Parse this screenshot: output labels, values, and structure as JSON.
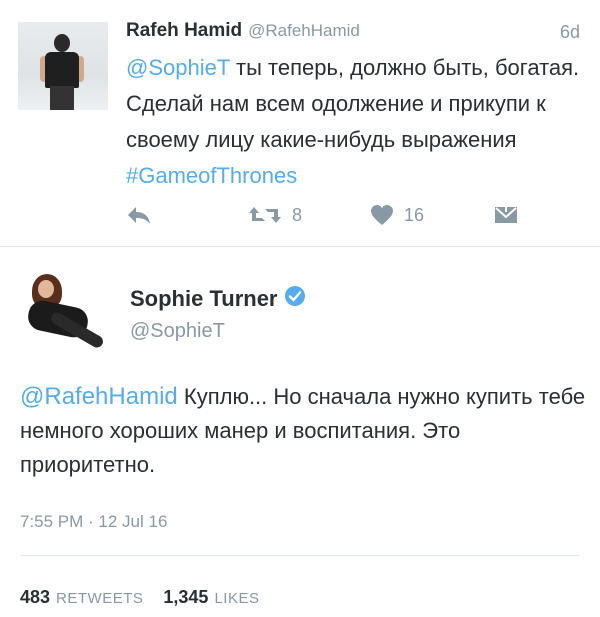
{
  "tweet1": {
    "name": "Rafeh Hamid",
    "handle": "@RafehHamid",
    "time": "6d",
    "mention": "@SophieT",
    "text_main": " ты теперь, должно быть, богатая. Сделай нам всем одолжение и прикупи к своему лицу какие-нибудь выражения ",
    "hashtag": "#GameofThrones",
    "actions": {
      "reply_icon": "reply-icon",
      "retweet_icon": "retweet-icon",
      "retweet_count": "8",
      "like_icon": "heart-icon",
      "like_count": "16",
      "dm_icon": "direct-message-icon"
    }
  },
  "tweet2": {
    "name": "Sophie Turner",
    "verified_icon": "verified-badge-icon",
    "handle": "@SophieT",
    "mention": "@RafehHamid",
    "text_main": " Куплю... Но сначала нужно купить тебе немного хороших манер и воспитания. Это приоритетно.",
    "date": "7:55 PM · 12 Jul 16",
    "retweets_count": "483",
    "retweets_label": "RETWEETS",
    "likes_count": "1,345",
    "likes_label": "LIKES"
  },
  "colors": {
    "accent": "#55acee",
    "muted": "#8899a6",
    "text": "#292f33",
    "divider": "#e1e8ed"
  }
}
